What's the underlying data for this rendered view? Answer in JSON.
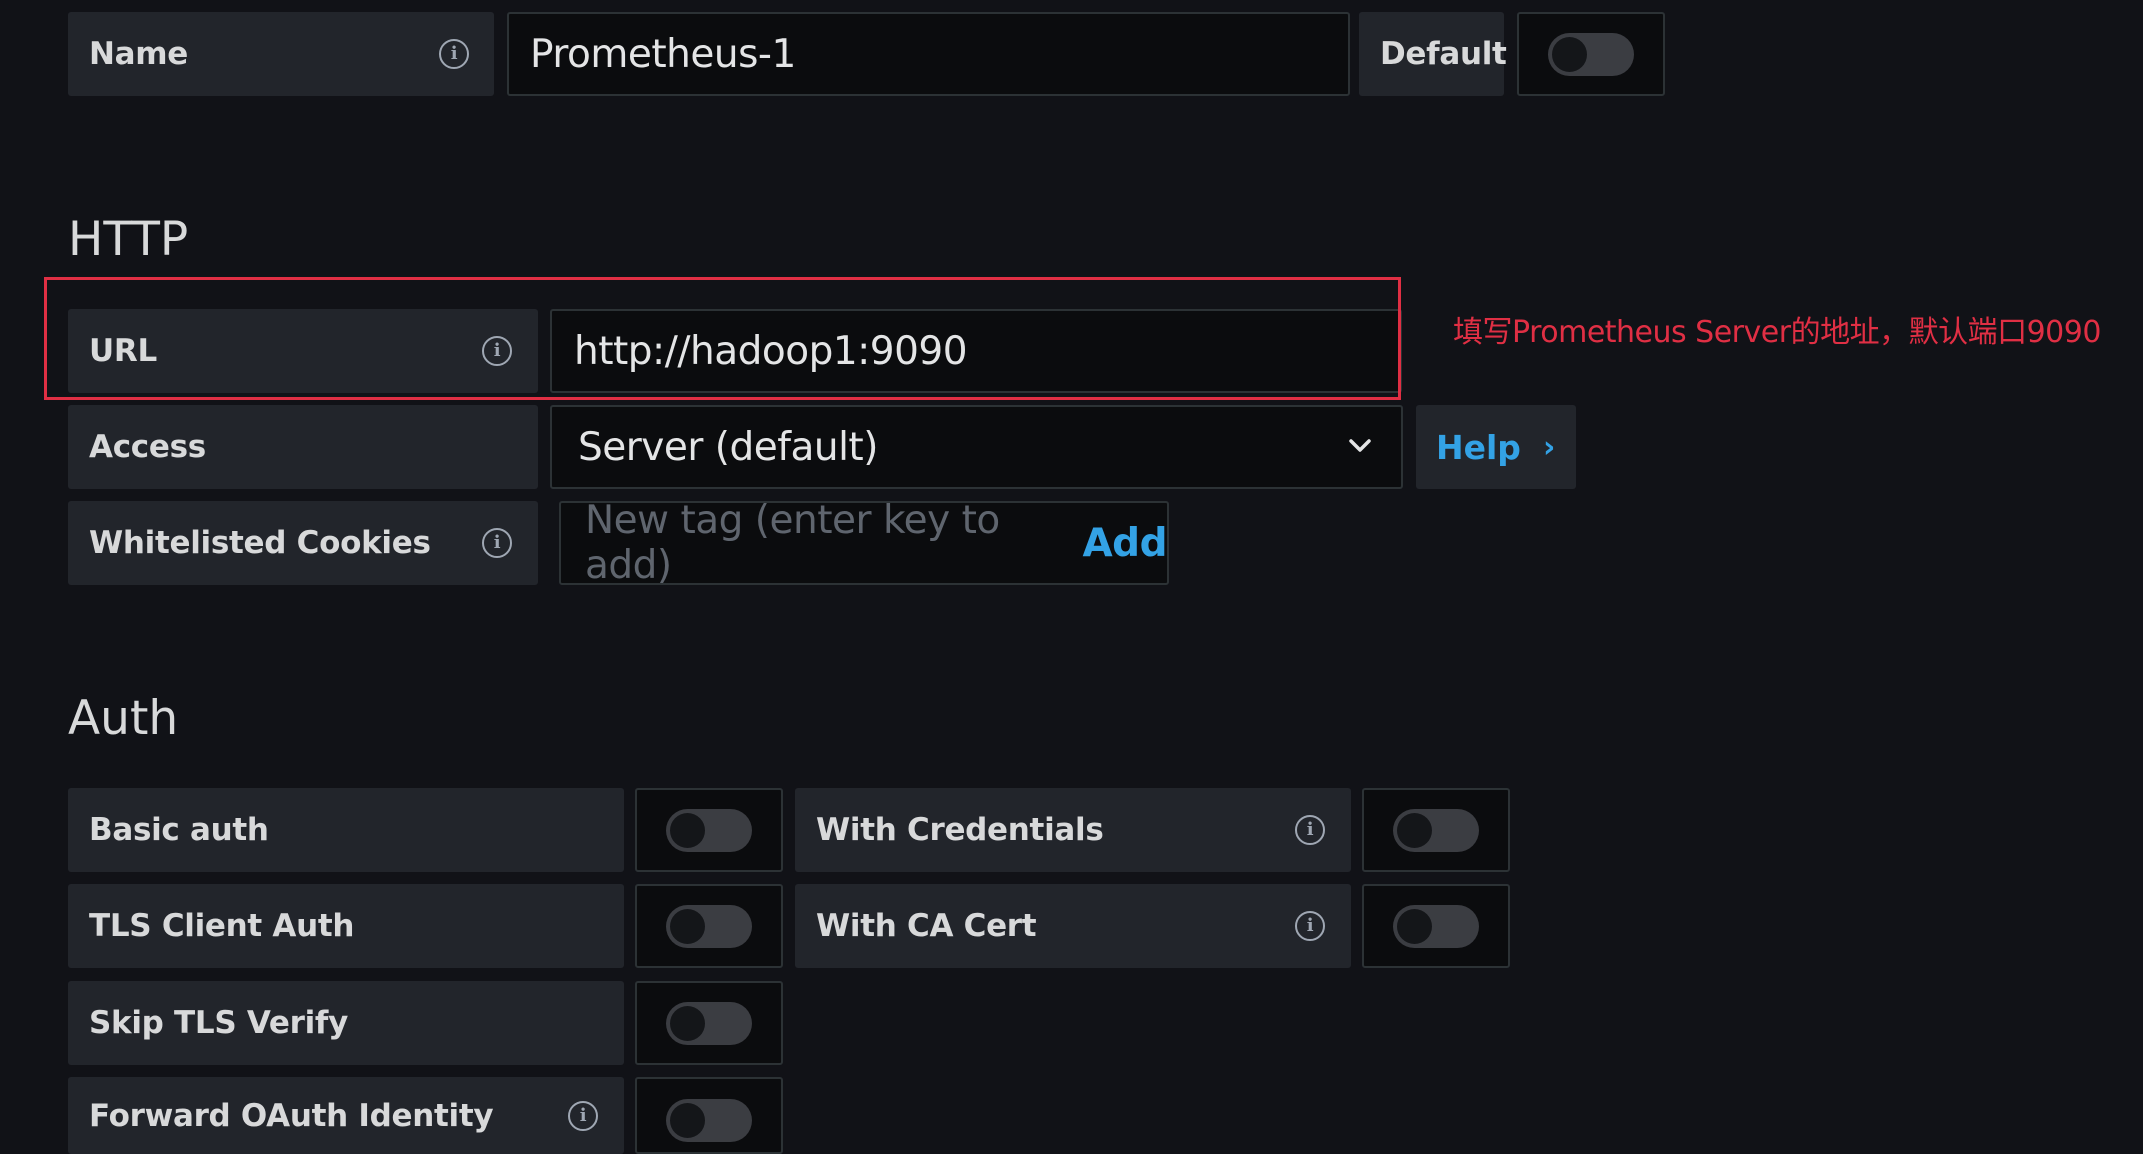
{
  "name_row": {
    "label": "Name",
    "value": "Prometheus-1",
    "default_label": "Default",
    "default_on": false
  },
  "http": {
    "heading": "HTTP",
    "url": {
      "label": "URL",
      "value": "http://hadoop1:9090"
    },
    "annotation": "填写Prometheus Server的地址，默认端口9090",
    "access": {
      "label": "Access",
      "value": "Server (default)",
      "help": "Help"
    },
    "cookies": {
      "label": "Whitelisted Cookies",
      "placeholder": "New tag (enter key to add)",
      "add": "Add"
    }
  },
  "auth": {
    "heading": "Auth",
    "basic_auth": "Basic auth",
    "with_credentials": "With Credentials",
    "tls_client_auth": "TLS Client Auth",
    "with_ca_cert": "With CA Cert",
    "skip_tls_verify": "Skip TLS Verify",
    "forward_oauth": "Forward OAuth Identity"
  },
  "colors": {
    "background": "#111217",
    "label_bg": "#22252b",
    "input_bg": "#0b0c0e",
    "accent_blue": "#33a2e5",
    "annotation_red": "#e02f44"
  },
  "icons": [
    "info-icon",
    "chevron-down-icon",
    "chevron-right-icon",
    "toggle-switch"
  ]
}
